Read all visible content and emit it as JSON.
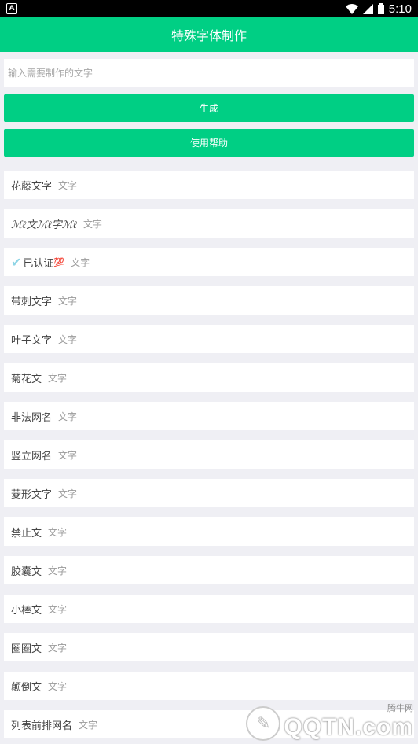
{
  "status_bar": {
    "notification_letter": "A",
    "time": "5:10"
  },
  "app_bar": {
    "title": "特殊字体制作"
  },
  "input": {
    "placeholder": "输入需要制作的文字",
    "value": ""
  },
  "buttons": {
    "generate_label": "生成",
    "help_label": "使用帮助"
  },
  "styles": [
    {
      "name": "花藤文字",
      "preview": "文字"
    },
    {
      "name": "ℳℓ文ℳℓ字ℳℓ",
      "preview": "文字"
    },
    {
      "name": "已认证",
      "preview": "文字"
    },
    {
      "name": "带刺文字",
      "preview": "文字"
    },
    {
      "name": "叶子文字",
      "preview": "文字"
    },
    {
      "name": "菊花文",
      "preview": "文字"
    },
    {
      "name": "非法网名",
      "preview": "文字"
    },
    {
      "name": "竖立网名",
      "preview": "文字"
    },
    {
      "name": "菱形文字",
      "preview": "文字"
    },
    {
      "name": "禁止文",
      "preview": "文字"
    },
    {
      "name": "胶囊文",
      "preview": "文字"
    },
    {
      "name": "小棒文",
      "preview": "文字"
    },
    {
      "name": "圈圈文",
      "preview": "文字"
    },
    {
      "name": "颠倒文",
      "preview": "文字"
    },
    {
      "name": "列表前排网名",
      "preview": "文字"
    }
  ],
  "verified_marks": {
    "check": "✔",
    "hundred": "💯"
  },
  "watermark": {
    "site": "腾牛网",
    "brand": "QQTN.com"
  },
  "colors": {
    "accent": "#00cf84",
    "background": "#efeff4"
  }
}
